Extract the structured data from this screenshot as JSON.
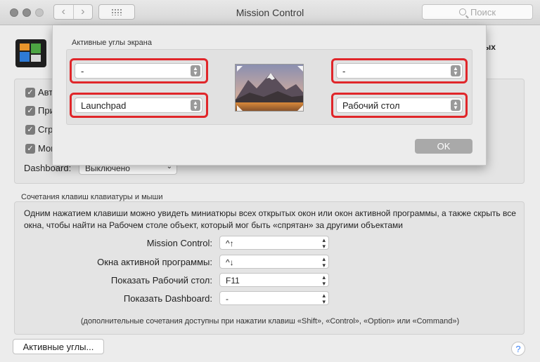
{
  "window": {
    "title": "Mission Control",
    "search_placeholder": "Поиск"
  },
  "background": {
    "heading_tail": "ых",
    "checkboxes": [
      {
        "label": "Авт",
        "checked": true
      },
      {
        "label": "При",
        "checked": true
      },
      {
        "label": "Сгр",
        "checked": true
      },
      {
        "label": "Мон",
        "checked": true
      }
    ],
    "dashboard_label": "Dashboard:",
    "dashboard_value": "Выключено"
  },
  "shortcuts": {
    "section_title": "Сочетания клавиш клавиатуры и мыши",
    "description": "Одним нажатием клавиши можно увидеть миниатюры всех открытых окон или окон активной программы, а также скрыть все окна, чтобы найти на Рабочем столе объект, который мог быть «спрятан» за другими объектами",
    "rows": [
      {
        "label": "Mission Control:",
        "value": "^↑"
      },
      {
        "label": "Окна активной программы:",
        "value": "^↓"
      },
      {
        "label": "Показать Рабочий стол:",
        "value": "F11"
      },
      {
        "label": "Показать Dashboard:",
        "value": "-"
      }
    ],
    "note": "(дополнительные сочетания доступны при нажатии клавиш «Shift», «Control», «Option» или «Command»)"
  },
  "hot_corners_button": "Активные углы...",
  "help_label": "?",
  "sheet": {
    "title": "Активные углы экрана",
    "top_left": "-",
    "top_right": "-",
    "bottom_left": "Launchpad",
    "bottom_right": "Рабочий стол",
    "ok_label": "OK"
  },
  "colors": {
    "highlight": "#e0262a",
    "ok_button": "#a9a9a9"
  }
}
